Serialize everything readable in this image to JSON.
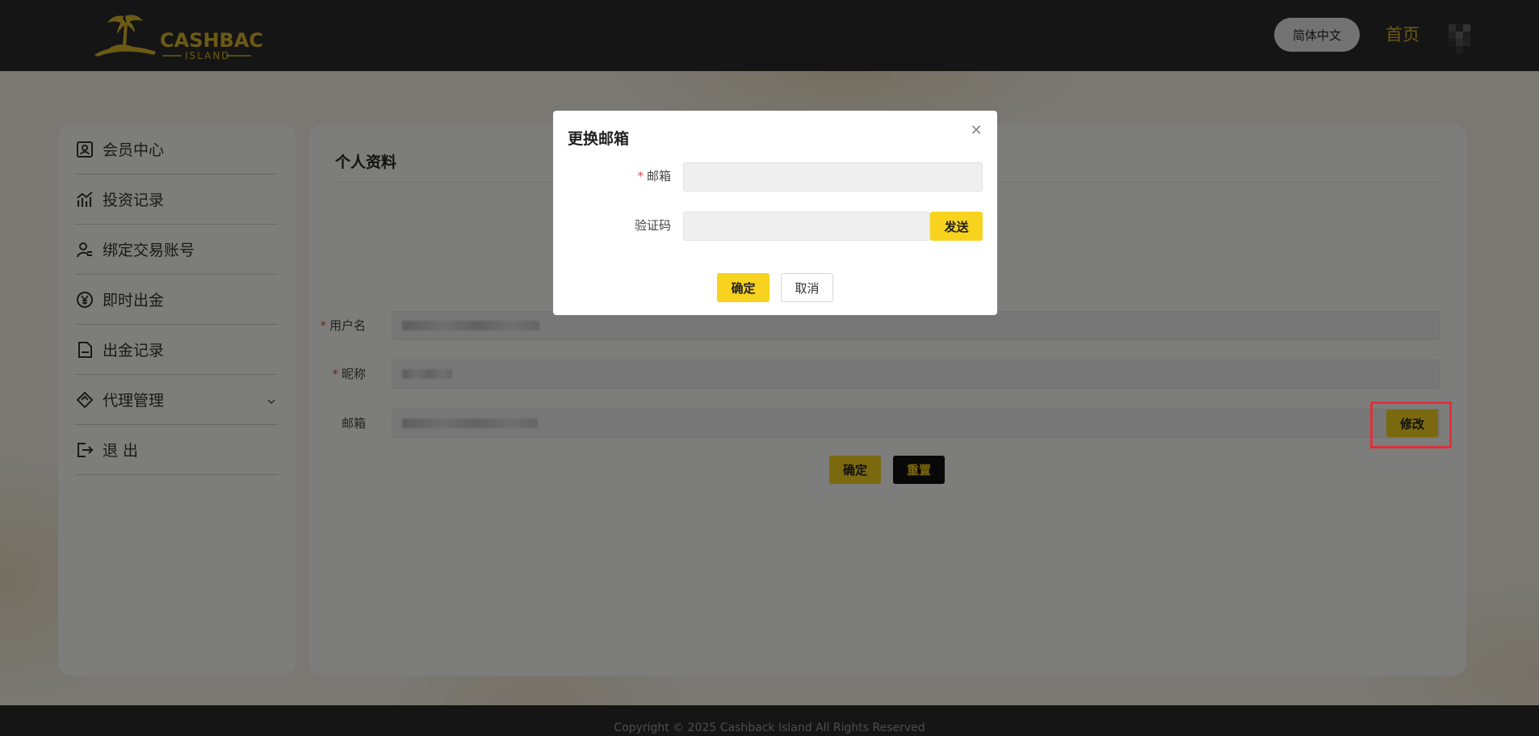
{
  "header": {
    "logo_title": "CASHBACK",
    "logo_subtitle": "ISLAND",
    "language": "简体中文",
    "home": "首页"
  },
  "sidebar": {
    "items": [
      {
        "label": "会员中心",
        "icon": "member-card-icon"
      },
      {
        "label": "投资记录",
        "icon": "chart-icon"
      },
      {
        "label": "绑定交易账号",
        "icon": "user-link-icon"
      },
      {
        "label": "即时出金",
        "icon": "yen-coin-icon"
      },
      {
        "label": "出金记录",
        "icon": "document-icon"
      },
      {
        "label": "代理管理",
        "icon": "handshake-icon"
      },
      {
        "label": "退 出",
        "icon": "logout-icon"
      }
    ]
  },
  "profile": {
    "title": "个人资料",
    "username_label": "用户名",
    "nickname_label": "昵称",
    "email_label": "邮箱",
    "modify": "修改",
    "confirm": "确定",
    "reset": "重置"
  },
  "modal": {
    "title": "更换邮箱",
    "email_label": "邮箱",
    "code_label": "验证码",
    "send": "发送",
    "confirm": "确定",
    "cancel": "取消"
  },
  "footer": {
    "copyright": "Copyright © 2025 Cashback Island All Rights Reserved"
  },
  "colors": {
    "accent": "#f7d21e",
    "header_bg": "#2b2b2b",
    "required": "#e14b4b",
    "highlight": "#e0303a"
  }
}
